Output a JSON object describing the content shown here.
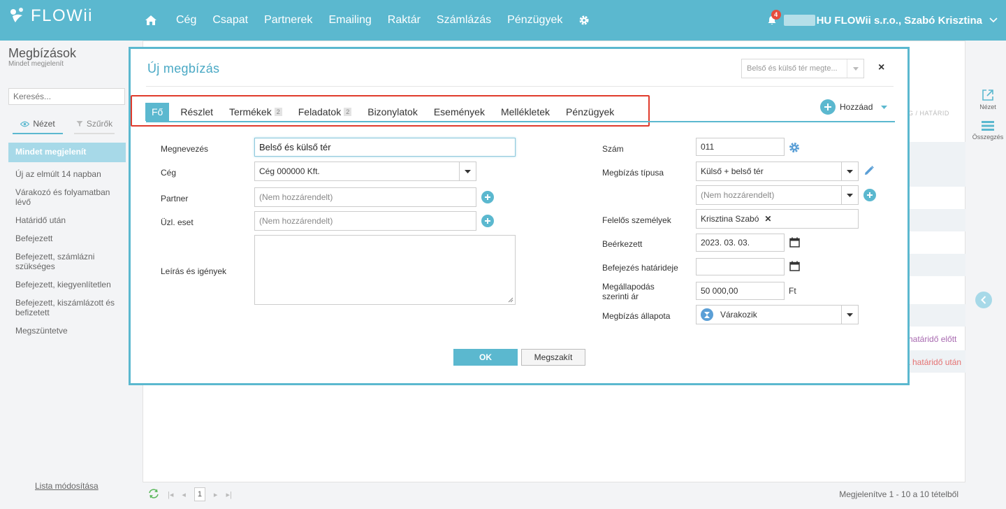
{
  "app": {
    "logo_text": "FLOWii",
    "nav": [
      "Cég",
      "Csapat",
      "Partnerek",
      "Emailing",
      "Raktár",
      "Számlázás",
      "Pénzügyek"
    ],
    "notifications": "4",
    "user": "HU FLOWii s.r.o., Szabó Krisztina"
  },
  "sidebar": {
    "title": "Megbízások",
    "subtitle": "Mindet megjelenít",
    "search_placeholder": "Keresés...",
    "tab_view": "Nézet",
    "tab_filter": "Szűrők",
    "items": [
      "Mindet megjelenít",
      "Új az elmúlt 14 napban",
      "Várakozó és folyamatban lévő",
      "Határidő után",
      "Befejezett",
      "Befejezett, számlázni szükséges",
      "Befejezett, kiegyenlítetlen",
      "Befejezett, kiszámlázott és befizetett",
      "Megszüntetve"
    ],
    "footer": "Lista módosítása"
  },
  "background": {
    "col_header": "G / HATÁRID",
    "status_before": "határidő előtt",
    "status_after": "a határidő után",
    "rail_view": "Nézet",
    "rail_summary": "Összegzés",
    "pager_page": "1",
    "pager_info": "Megjelenítve 1 - 10 a 10 tételből"
  },
  "modal": {
    "title": "Új megbízás",
    "top_select": "Belső és külső tér megte...",
    "close": "×",
    "tabs": [
      {
        "label": "Fő",
        "count": ""
      },
      {
        "label": "Részlet",
        "count": ""
      },
      {
        "label": "Termékek",
        "count": "2"
      },
      {
        "label": "Feladatok",
        "count": "2"
      },
      {
        "label": "Bizonylatok",
        "count": ""
      },
      {
        "label": "Események",
        "count": ""
      },
      {
        "label": "Mellékletek",
        "count": ""
      },
      {
        "label": "Pénzügyek",
        "count": ""
      }
    ],
    "add_label": "Hozzáad",
    "left": {
      "name_label": "Megnevezés",
      "name_value": "Belső és külső tér",
      "company_label": "Cég",
      "company_value": "Cég 000000 Kft.",
      "partner_label": "Partner",
      "partner_value": "(Nem hozzárendelt)",
      "case_label": "Üzl. eset",
      "case_value": "(Nem hozzárendelt)",
      "desc_label": "Leírás és igények"
    },
    "right": {
      "number_label": "Szám",
      "number_value": "011",
      "type_label": "Megbízás típusa",
      "type_value": "Külső + belső tér",
      "type2_value": "(Nem hozzárendelt)",
      "resp_label": "Felelős személyek",
      "resp_value": "Krisztina Szabó",
      "received_label": "Beérkezett",
      "received_value": "2023. 03. 03.",
      "deadline_label": "Befejezés határideje",
      "deadline_value": "",
      "price_label": "Megállapodás szerinti ár",
      "price_value": "50 000,00",
      "price_unit": "Ft",
      "status_label": "Megbízás állapota",
      "status_value": "Várakozik"
    },
    "ok": "OK",
    "cancel": "Megszakít"
  }
}
